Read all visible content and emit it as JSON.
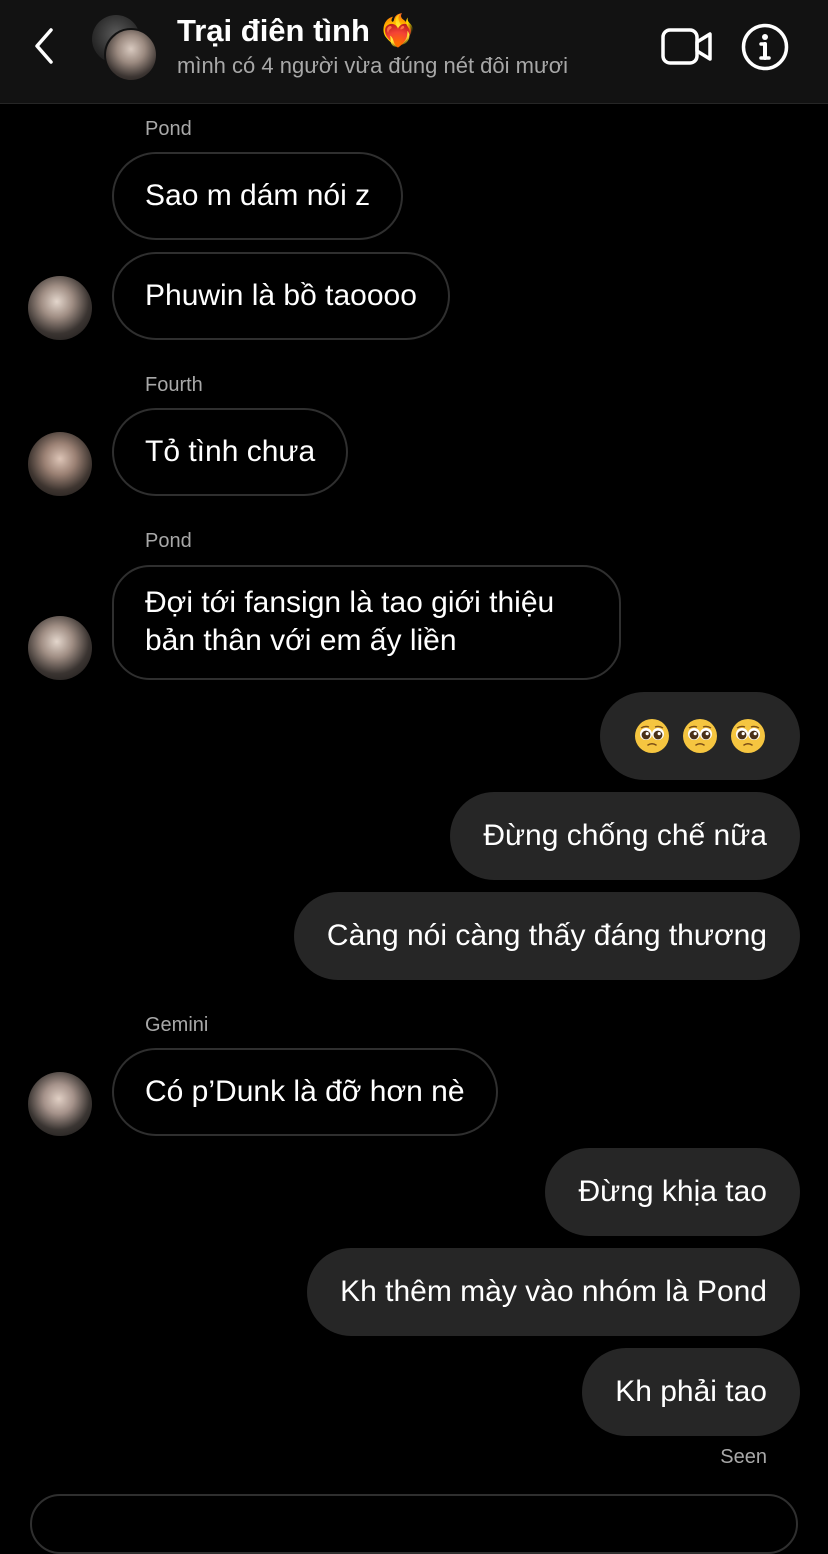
{
  "header": {
    "title": "Trại điên tình ❤️‍🔥",
    "subtitle": "mình có 4 người vừa đúng nét đôi mươi"
  },
  "messages": [
    {
      "sender": "Pond",
      "text": "Sao m dám nói z"
    },
    {
      "sender": "Pond",
      "text": "Phuwin là bồ taoooo"
    },
    {
      "sender": "Fourth",
      "text": "Tỏ tình chưa"
    },
    {
      "sender": "Pond",
      "text_line1": "Đợi tới fansign là tao giới thiệu",
      "text_line2": "bản thân với em ấy liền"
    },
    {
      "sender": "me",
      "emoji": [
        "🥹",
        "🥹",
        "🥹"
      ]
    },
    {
      "sender": "me",
      "text": "Đừng chống chế nữa"
    },
    {
      "sender": "me",
      "text": "Càng nói càng thấy đáng thương"
    },
    {
      "sender": "Gemini",
      "text": "Có p’Dunk là đỡ hơn nè"
    },
    {
      "sender": "me",
      "text": "Đừng khịa tao"
    },
    {
      "sender": "me",
      "text": "Kh thêm mày vào nhóm là Pond"
    },
    {
      "sender": "me",
      "text": "Kh phải tao"
    }
  ],
  "seen_label": "Seen",
  "colors": {
    "background": "#000000",
    "header_bg": "#121212",
    "outgoing_bubble": "#262626",
    "incoming_border": "#2f2f2f",
    "secondary_text": "#a8a8a8"
  }
}
